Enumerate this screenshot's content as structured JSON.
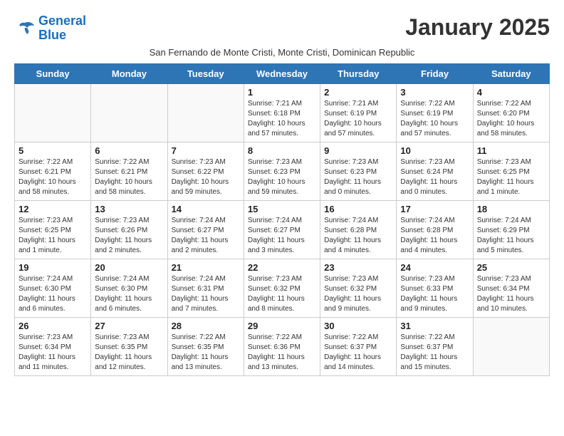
{
  "logo": {
    "line1": "General",
    "line2": "Blue"
  },
  "title": "January 2025",
  "subtitle": "San Fernando de Monte Cristi, Monte Cristi, Dominican Republic",
  "header_days": [
    "Sunday",
    "Monday",
    "Tuesday",
    "Wednesday",
    "Thursday",
    "Friday",
    "Saturday"
  ],
  "weeks": [
    [
      {
        "day": "",
        "info": ""
      },
      {
        "day": "",
        "info": ""
      },
      {
        "day": "",
        "info": ""
      },
      {
        "day": "1",
        "info": "Sunrise: 7:21 AM\nSunset: 6:18 PM\nDaylight: 10 hours\nand 57 minutes."
      },
      {
        "day": "2",
        "info": "Sunrise: 7:21 AM\nSunset: 6:19 PM\nDaylight: 10 hours\nand 57 minutes."
      },
      {
        "day": "3",
        "info": "Sunrise: 7:22 AM\nSunset: 6:19 PM\nDaylight: 10 hours\nand 57 minutes."
      },
      {
        "day": "4",
        "info": "Sunrise: 7:22 AM\nSunset: 6:20 PM\nDaylight: 10 hours\nand 58 minutes."
      }
    ],
    [
      {
        "day": "5",
        "info": "Sunrise: 7:22 AM\nSunset: 6:21 PM\nDaylight: 10 hours\nand 58 minutes."
      },
      {
        "day": "6",
        "info": "Sunrise: 7:22 AM\nSunset: 6:21 PM\nDaylight: 10 hours\nand 58 minutes."
      },
      {
        "day": "7",
        "info": "Sunrise: 7:23 AM\nSunset: 6:22 PM\nDaylight: 10 hours\nand 59 minutes."
      },
      {
        "day": "8",
        "info": "Sunrise: 7:23 AM\nSunset: 6:23 PM\nDaylight: 10 hours\nand 59 minutes."
      },
      {
        "day": "9",
        "info": "Sunrise: 7:23 AM\nSunset: 6:23 PM\nDaylight: 11 hours\nand 0 minutes."
      },
      {
        "day": "10",
        "info": "Sunrise: 7:23 AM\nSunset: 6:24 PM\nDaylight: 11 hours\nand 0 minutes."
      },
      {
        "day": "11",
        "info": "Sunrise: 7:23 AM\nSunset: 6:25 PM\nDaylight: 11 hours\nand 1 minute."
      }
    ],
    [
      {
        "day": "12",
        "info": "Sunrise: 7:23 AM\nSunset: 6:25 PM\nDaylight: 11 hours\nand 1 minute."
      },
      {
        "day": "13",
        "info": "Sunrise: 7:23 AM\nSunset: 6:26 PM\nDaylight: 11 hours\nand 2 minutes."
      },
      {
        "day": "14",
        "info": "Sunrise: 7:24 AM\nSunset: 6:27 PM\nDaylight: 11 hours\nand 2 minutes."
      },
      {
        "day": "15",
        "info": "Sunrise: 7:24 AM\nSunset: 6:27 PM\nDaylight: 11 hours\nand 3 minutes."
      },
      {
        "day": "16",
        "info": "Sunrise: 7:24 AM\nSunset: 6:28 PM\nDaylight: 11 hours\nand 4 minutes."
      },
      {
        "day": "17",
        "info": "Sunrise: 7:24 AM\nSunset: 6:28 PM\nDaylight: 11 hours\nand 4 minutes."
      },
      {
        "day": "18",
        "info": "Sunrise: 7:24 AM\nSunset: 6:29 PM\nDaylight: 11 hours\nand 5 minutes."
      }
    ],
    [
      {
        "day": "19",
        "info": "Sunrise: 7:24 AM\nSunset: 6:30 PM\nDaylight: 11 hours\nand 6 minutes."
      },
      {
        "day": "20",
        "info": "Sunrise: 7:24 AM\nSunset: 6:30 PM\nDaylight: 11 hours\nand 6 minutes."
      },
      {
        "day": "21",
        "info": "Sunrise: 7:24 AM\nSunset: 6:31 PM\nDaylight: 11 hours\nand 7 minutes."
      },
      {
        "day": "22",
        "info": "Sunrise: 7:23 AM\nSunset: 6:32 PM\nDaylight: 11 hours\nand 8 minutes."
      },
      {
        "day": "23",
        "info": "Sunrise: 7:23 AM\nSunset: 6:32 PM\nDaylight: 11 hours\nand 9 minutes."
      },
      {
        "day": "24",
        "info": "Sunrise: 7:23 AM\nSunset: 6:33 PM\nDaylight: 11 hours\nand 9 minutes."
      },
      {
        "day": "25",
        "info": "Sunrise: 7:23 AM\nSunset: 6:34 PM\nDaylight: 11 hours\nand 10 minutes."
      }
    ],
    [
      {
        "day": "26",
        "info": "Sunrise: 7:23 AM\nSunset: 6:34 PM\nDaylight: 11 hours\nand 11 minutes."
      },
      {
        "day": "27",
        "info": "Sunrise: 7:23 AM\nSunset: 6:35 PM\nDaylight: 11 hours\nand 12 minutes."
      },
      {
        "day": "28",
        "info": "Sunrise: 7:22 AM\nSunset: 6:35 PM\nDaylight: 11 hours\nand 13 minutes."
      },
      {
        "day": "29",
        "info": "Sunrise: 7:22 AM\nSunset: 6:36 PM\nDaylight: 11 hours\nand 13 minutes."
      },
      {
        "day": "30",
        "info": "Sunrise: 7:22 AM\nSunset: 6:37 PM\nDaylight: 11 hours\nand 14 minutes."
      },
      {
        "day": "31",
        "info": "Sunrise: 7:22 AM\nSunset: 6:37 PM\nDaylight: 11 hours\nand 15 minutes."
      },
      {
        "day": "",
        "info": ""
      }
    ]
  ]
}
